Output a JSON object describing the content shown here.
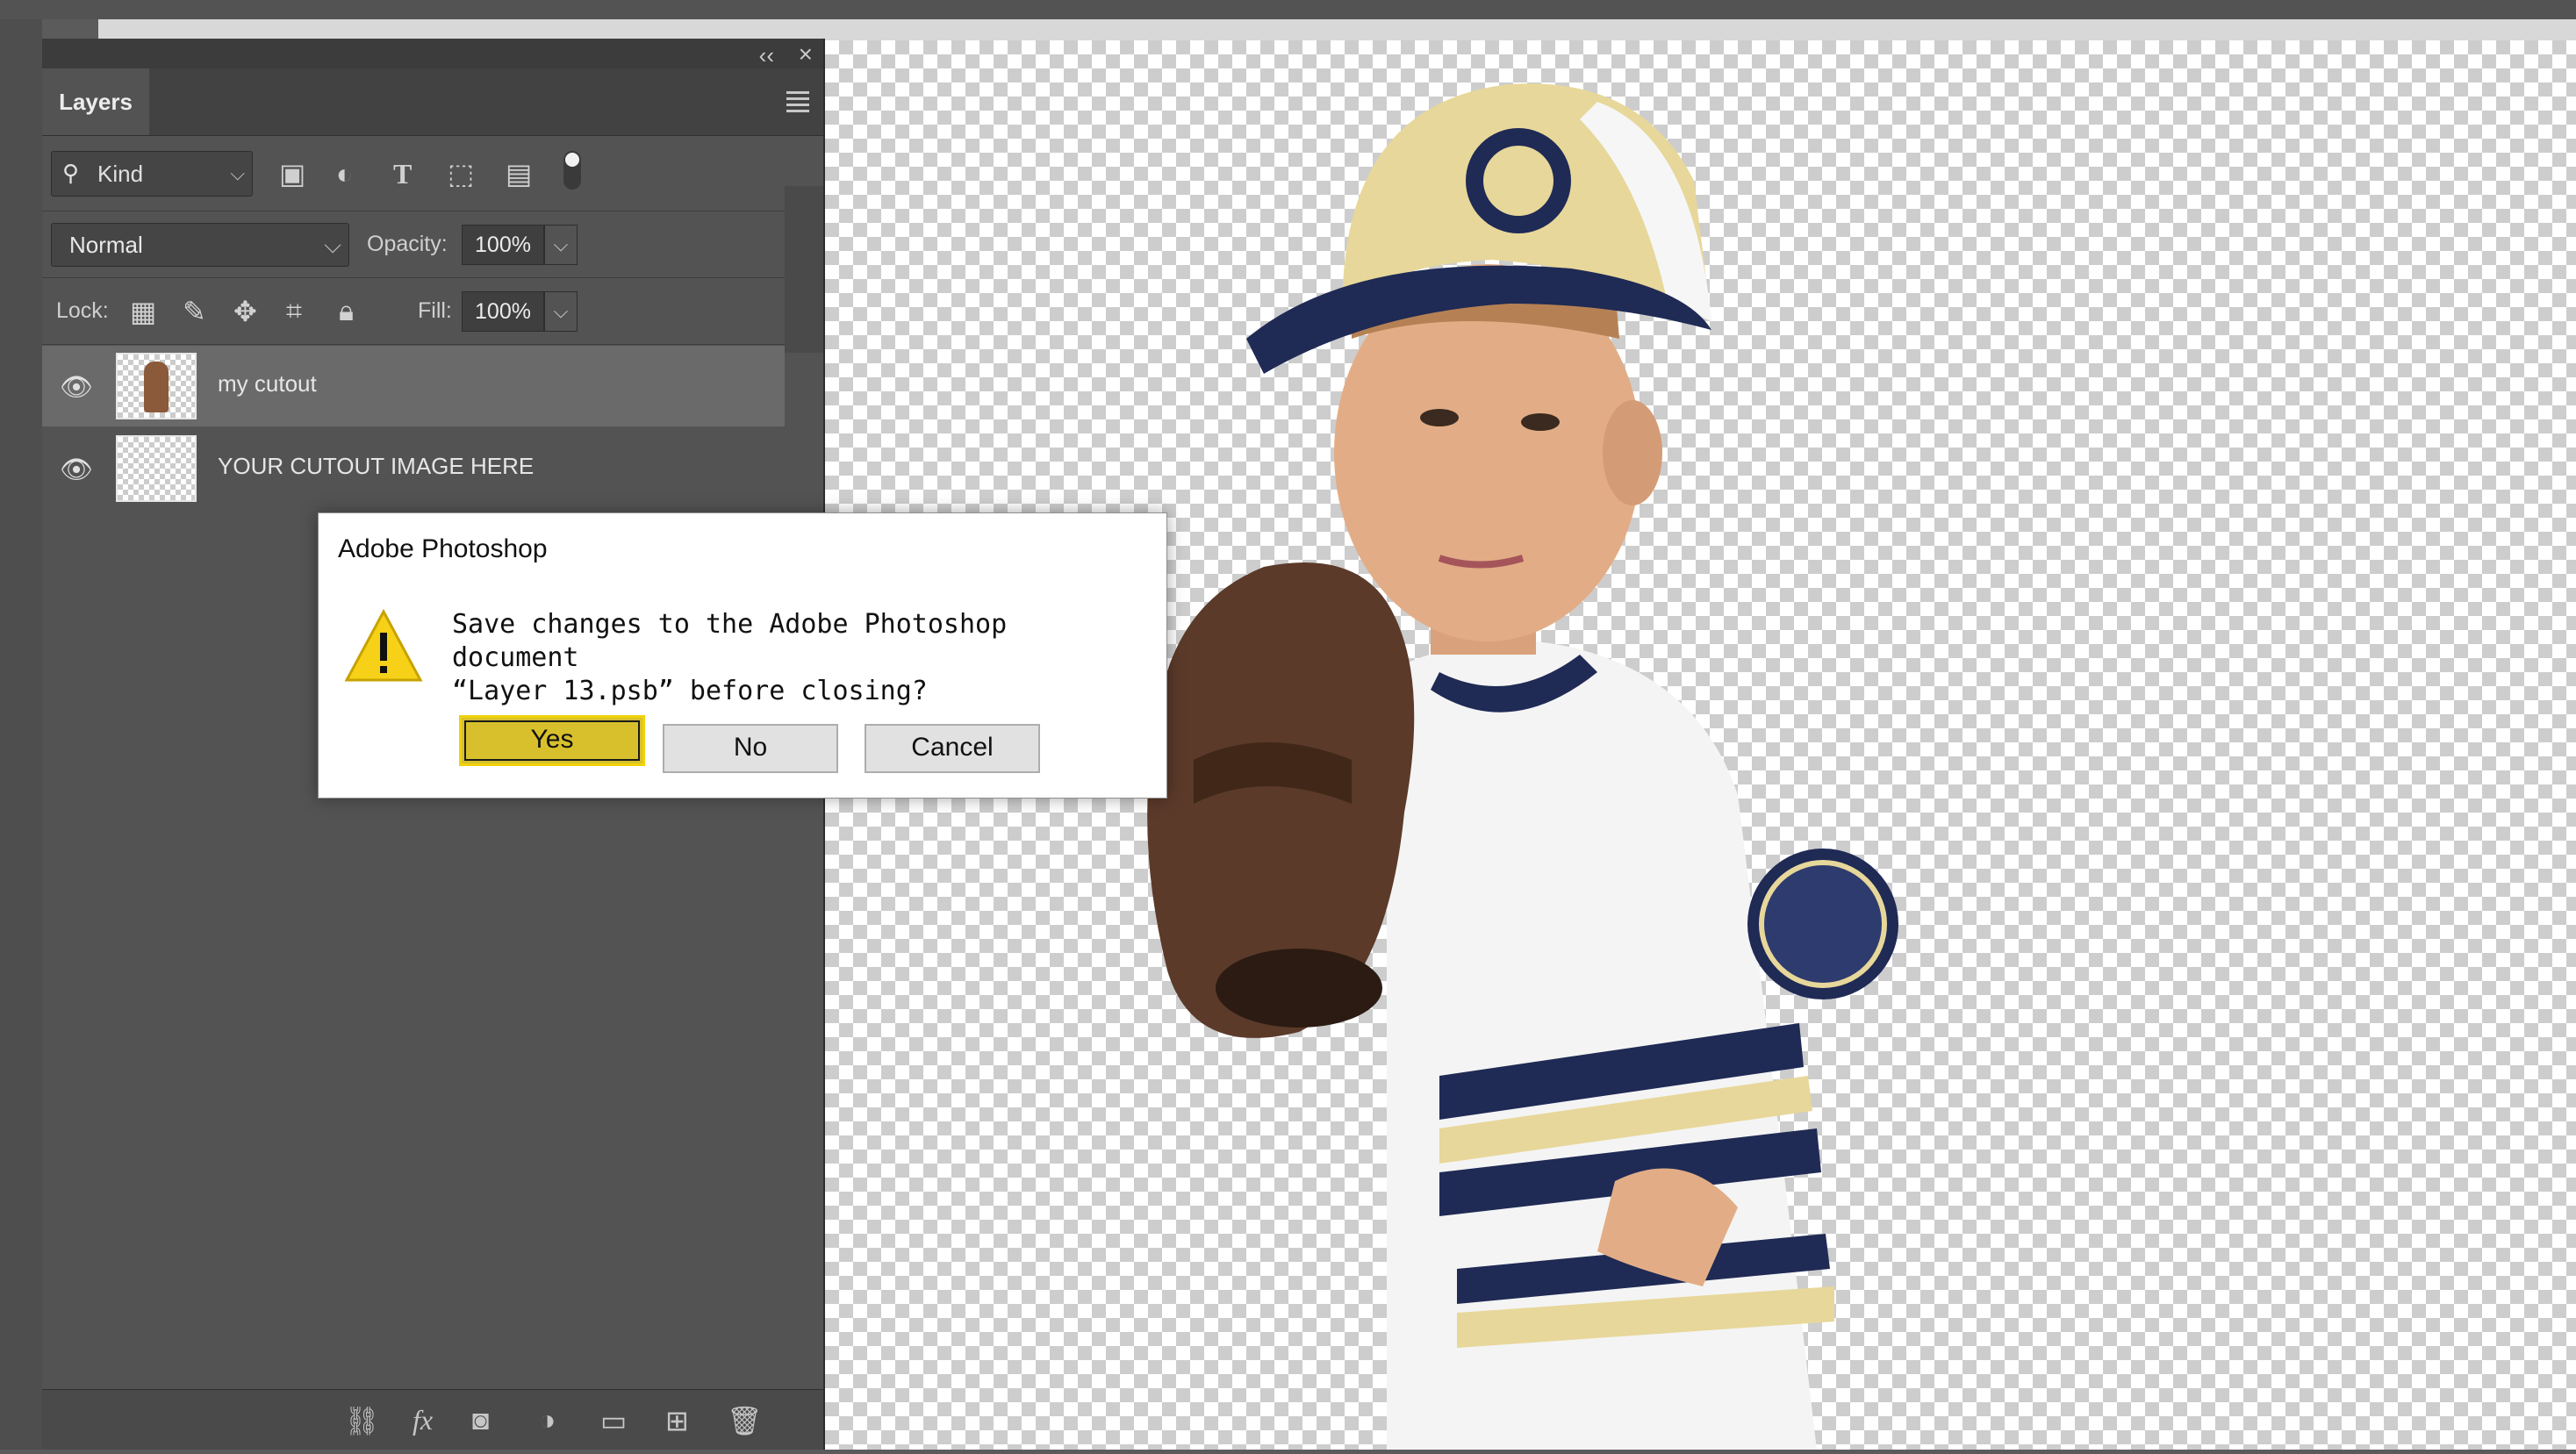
{
  "app": "Adobe Photoshop",
  "layers_panel": {
    "tab_label": "Layers",
    "filter_kind": "Kind",
    "blend_mode": "Normal",
    "opacity_label": "Opacity:",
    "opacity_value": "100%",
    "lock_label": "Lock:",
    "fill_label": "Fill:",
    "fill_value": "100%",
    "layers": [
      {
        "name": "my cutout",
        "selected": true,
        "visible": true
      },
      {
        "name": "YOUR CUTOUT IMAGE HERE",
        "selected": false,
        "visible": true
      }
    ]
  },
  "dialog": {
    "title": "Adobe Photoshop",
    "message_line1": "Save changes to the Adobe Photoshop document",
    "message_line2": "“Layer 13.psb” before closing?",
    "yes_label": "Yes",
    "no_label": "No",
    "cancel_label": "Cancel"
  },
  "colors": {
    "panel_bg": "#535353",
    "selected_layer": "#6a6a6a",
    "default_button": "#d8c02c",
    "jersey_navy": "#1f2a55",
    "cap_gold": "#e7d79a",
    "glove_brown": "#5b3a2a"
  }
}
